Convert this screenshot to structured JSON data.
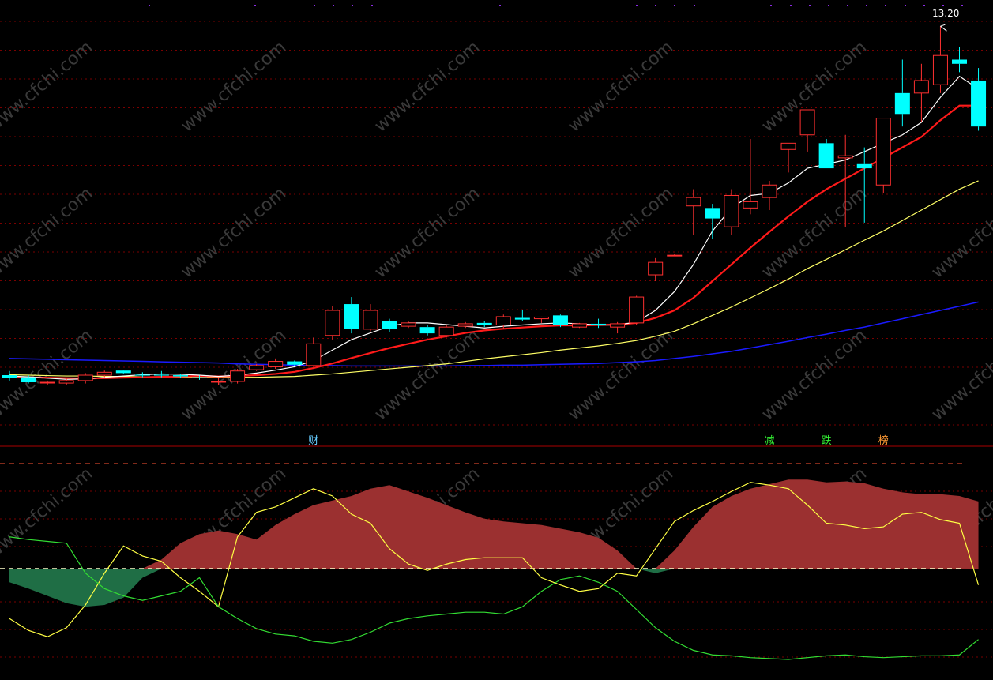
{
  "chart_data": [
    {
      "type": "candlestick",
      "title": "",
      "price_label": "13.20",
      "ylim": [
        4.0,
        13.6
      ],
      "colors": {
        "up": "#ff3030",
        "down": "#00ffff",
        "ma5": "#ffffff",
        "ma10": "#ff1a1a",
        "ma20": "#ffff66",
        "ma60": "#1a1aff",
        "grid": "#7a0000"
      },
      "candles": [
        {
          "o": 4.85,
          "h": 4.95,
          "l": 4.72,
          "c": 4.78
        },
        {
          "o": 4.8,
          "h": 4.85,
          "l": 4.65,
          "c": 4.68
        },
        {
          "o": 4.68,
          "h": 4.72,
          "l": 4.62,
          "c": 4.68
        },
        {
          "o": 4.66,
          "h": 4.78,
          "l": 4.62,
          "c": 4.72
        },
        {
          "o": 4.72,
          "h": 4.9,
          "l": 4.65,
          "c": 4.85
        },
        {
          "o": 4.85,
          "h": 4.96,
          "l": 4.8,
          "c": 4.92
        },
        {
          "o": 4.96,
          "h": 4.98,
          "l": 4.88,
          "c": 4.9
        },
        {
          "o": 4.86,
          "h": 4.92,
          "l": 4.8,
          "c": 4.84
        },
        {
          "o": 4.86,
          "h": 4.95,
          "l": 4.8,
          "c": 4.84
        },
        {
          "o": 4.85,
          "h": 4.88,
          "l": 4.78,
          "c": 4.82
        },
        {
          "o": 4.8,
          "h": 4.84,
          "l": 4.74,
          "c": 4.78
        },
        {
          "o": 4.7,
          "h": 4.78,
          "l": 4.62,
          "c": 4.7
        },
        {
          "o": 4.7,
          "h": 5.0,
          "l": 4.65,
          "c": 4.95
        },
        {
          "o": 4.98,
          "h": 5.12,
          "l": 4.95,
          "c": 5.08
        },
        {
          "o": 5.05,
          "h": 5.25,
          "l": 5.0,
          "c": 5.18
        },
        {
          "o": 5.18,
          "h": 5.2,
          "l": 5.08,
          "c": 5.1
        },
        {
          "o": 5.08,
          "h": 5.75,
          "l": 5.05,
          "c": 5.6
        },
        {
          "o": 5.8,
          "h": 6.5,
          "l": 5.7,
          "c": 6.4
        },
        {
          "o": 6.55,
          "h": 6.72,
          "l": 5.85,
          "c": 5.95
        },
        {
          "o": 5.95,
          "h": 6.55,
          "l": 5.9,
          "c": 6.4
        },
        {
          "o": 6.15,
          "h": 6.2,
          "l": 5.88,
          "c": 5.95
        },
        {
          "o": 6.02,
          "h": 6.15,
          "l": 5.98,
          "c": 6.1
        },
        {
          "o": 6.0,
          "h": 6.05,
          "l": 5.8,
          "c": 5.85
        },
        {
          "o": 5.8,
          "h": 6.05,
          "l": 5.75,
          "c": 6.0
        },
        {
          "o": 6.02,
          "h": 6.12,
          "l": 5.98,
          "c": 6.08
        },
        {
          "o": 6.1,
          "h": 6.15,
          "l": 6.0,
          "c": 6.05
        },
        {
          "o": 6.05,
          "h": 6.3,
          "l": 5.95,
          "c": 6.25
        },
        {
          "o": 6.22,
          "h": 6.4,
          "l": 6.15,
          "c": 6.18
        },
        {
          "o": 6.2,
          "h": 6.25,
          "l": 6.1,
          "c": 6.24
        },
        {
          "o": 6.28,
          "h": 6.3,
          "l": 6.0,
          "c": 6.05
        },
        {
          "o": 6.0,
          "h": 6.1,
          "l": 5.98,
          "c": 6.08
        },
        {
          "o": 6.08,
          "h": 6.2,
          "l": 5.98,
          "c": 6.05
        },
        {
          "o": 6.0,
          "h": 6.12,
          "l": 5.85,
          "c": 6.08
        },
        {
          "o": 6.1,
          "h": 6.75,
          "l": 6.05,
          "c": 6.72
        },
        {
          "o": 7.25,
          "h": 7.65,
          "l": 7.1,
          "c": 7.55
        },
        {
          "o": 7.72,
          "h": 7.74,
          "l": 7.7,
          "c": 7.72
        },
        {
          "o": 8.9,
          "h": 9.3,
          "l": 8.2,
          "c": 9.1
        },
        {
          "o": 8.85,
          "h": 8.95,
          "l": 8.1,
          "c": 8.6
        },
        {
          "o": 8.4,
          "h": 9.3,
          "l": 8.2,
          "c": 9.15
        },
        {
          "o": 8.85,
          "h": 10.5,
          "l": 8.7,
          "c": 9.0
        },
        {
          "o": 9.1,
          "h": 9.5,
          "l": 8.8,
          "c": 9.4
        },
        {
          "o": 10.25,
          "h": 10.3,
          "l": 9.7,
          "c": 10.4
        },
        {
          "o": 10.6,
          "h": 11.2,
          "l": 10.2,
          "c": 11.2
        },
        {
          "o": 10.4,
          "h": 10.5,
          "l": 9.8,
          "c": 9.8
        },
        {
          "o": 10.05,
          "h": 10.6,
          "l": 8.4,
          "c": 10.1
        },
        {
          "o": 9.9,
          "h": 10.3,
          "l": 8.5,
          "c": 9.8
        },
        {
          "o": 9.4,
          "h": 10.9,
          "l": 9.2,
          "c": 11.0
        },
        {
          "o": 11.6,
          "h": 12.4,
          "l": 10.8,
          "c": 11.1
        },
        {
          "o": 11.6,
          "h": 12.3,
          "l": 10.9,
          "c": 11.9
        },
        {
          "o": 11.8,
          "h": 13.2,
          "l": 11.6,
          "c": 12.5
        },
        {
          "o": 12.4,
          "h": 12.7,
          "l": 12.1,
          "c": 12.3
        },
        {
          "o": 11.9,
          "h": 12.2,
          "l": 10.7,
          "c": 10.8
        }
      ],
      "ma5": [
        4.83,
        4.81,
        4.78,
        4.75,
        4.76,
        4.8,
        4.83,
        4.86,
        4.88,
        4.87,
        4.85,
        4.82,
        4.85,
        4.9,
        4.97,
        5.05,
        5.2,
        5.45,
        5.7,
        5.86,
        6.02,
        6.1,
        6.1,
        6.06,
        6.02,
        5.98,
        6.02,
        6.05,
        6.08,
        6.1,
        6.08,
        6.05,
        6.05,
        6.12,
        6.4,
        6.85,
        7.5,
        8.3,
        8.85,
        9.15,
        9.2,
        9.45,
        9.8,
        9.9,
        10.0,
        10.2,
        10.4,
        10.6,
        10.9,
        11.5,
        12.0,
        11.7
      ],
      "ma10": [
        4.8,
        4.8,
        4.79,
        4.78,
        4.77,
        4.78,
        4.79,
        4.8,
        4.81,
        4.82,
        4.83,
        4.82,
        4.83,
        4.85,
        4.88,
        4.93,
        5.02,
        5.13,
        5.26,
        5.38,
        5.5,
        5.6,
        5.7,
        5.78,
        5.86,
        5.92,
        5.96,
        5.99,
        6.02,
        6.04,
        6.04,
        6.05,
        6.06,
        6.1,
        6.22,
        6.4,
        6.7,
        7.1,
        7.5,
        7.9,
        8.28,
        8.65,
        9.0,
        9.3,
        9.55,
        9.8,
        10.05,
        10.3,
        10.55,
        10.95,
        11.3,
        11.3
      ],
      "ma20": [
        4.86,
        4.85,
        4.84,
        4.83,
        4.83,
        4.82,
        4.82,
        4.81,
        4.81,
        4.8,
        4.8,
        4.8,
        4.8,
        4.8,
        4.81,
        4.82,
        4.85,
        4.88,
        4.92,
        4.96,
        5.0,
        5.04,
        5.08,
        5.12,
        5.18,
        5.24,
        5.29,
        5.34,
        5.39,
        5.45,
        5.5,
        5.55,
        5.61,
        5.68,
        5.78,
        5.9,
        6.08,
        6.28,
        6.48,
        6.7,
        6.92,
        7.15,
        7.4,
        7.62,
        7.85,
        8.08,
        8.3,
        8.55,
        8.8,
        9.05,
        9.3,
        9.5
      ],
      "ma60": [
        5.25,
        5.24,
        5.23,
        5.22,
        5.21,
        5.2,
        5.19,
        5.18,
        5.17,
        5.16,
        5.15,
        5.14,
        5.12,
        5.11,
        5.1,
        5.09,
        5.08,
        5.08,
        5.07,
        5.07,
        5.07,
        5.07,
        5.07,
        5.07,
        5.08,
        5.08,
        5.09,
        5.09,
        5.1,
        5.11,
        5.12,
        5.13,
        5.15,
        5.17,
        5.2,
        5.25,
        5.3,
        5.36,
        5.42,
        5.5,
        5.58,
        5.66,
        5.75,
        5.83,
        5.92,
        6.0,
        6.1,
        6.2,
        6.3,
        6.4,
        6.5,
        6.6
      ]
    },
    {
      "type": "area",
      "title": "",
      "ylim": [
        -100,
        100
      ],
      "zero_line": 0,
      "colors": {
        "area_pos": "#9b3030",
        "area_neg": "#1f6e45",
        "yellow": "#ffff44",
        "green": "#33dd33"
      },
      "area": [
        -15,
        -22,
        -30,
        -38,
        -42,
        -40,
        -32,
        -10,
        10,
        28,
        38,
        42,
        38,
        32,
        48,
        60,
        70,
        75,
        80,
        88,
        92,
        85,
        78,
        70,
        62,
        55,
        52,
        50,
        48,
        44,
        40,
        34,
        20,
        0,
        -5,
        20,
        46,
        68,
        80,
        88,
        93,
        98,
        98,
        95,
        96,
        94,
        88,
        84,
        82,
        82,
        80,
        74
      ],
      "yellow": [
        -55,
        -68,
        -75,
        -65,
        -40,
        -5,
        25,
        14,
        8,
        -10,
        -25,
        -42,
        35,
        62,
        68,
        78,
        88,
        80,
        60,
        50,
        22,
        5,
        -2,
        5,
        10,
        12,
        12,
        12,
        -10,
        -18,
        -25,
        -22,
        -5,
        -8,
        22,
        52,
        64,
        74,
        85,
        95,
        92,
        88,
        70,
        50,
        48,
        44,
        46,
        60,
        62,
        54,
        50,
        -18
      ],
      "green": [
        35,
        32,
        30,
        28,
        -5,
        -22,
        -30,
        -35,
        -30,
        -25,
        -10,
        -42,
        -55,
        -66,
        -72,
        -74,
        -80,
        -82,
        -78,
        -70,
        -60,
        -55,
        -52,
        -50,
        -48,
        -48,
        -50,
        -42,
        -25,
        -12,
        -8,
        -15,
        -25,
        -45,
        -65,
        -80,
        -90,
        -95,
        -96,
        -98,
        -99,
        -100,
        -98,
        -96,
        -95,
        -97,
        -98,
        -97,
        -96,
        -96,
        -95,
        -78
      ]
    }
  ],
  "markers": [
    {
      "label": "财",
      "color": "#66ccff",
      "index": 16
    },
    {
      "label": "减",
      "color": "#33ee33",
      "index": 40
    },
    {
      "label": "跌",
      "color": "#33ee33",
      "index": 43
    },
    {
      "label": "榜",
      "color": "#ff9933",
      "index": 46
    }
  ],
  "watermark": "www.cfchi.com"
}
